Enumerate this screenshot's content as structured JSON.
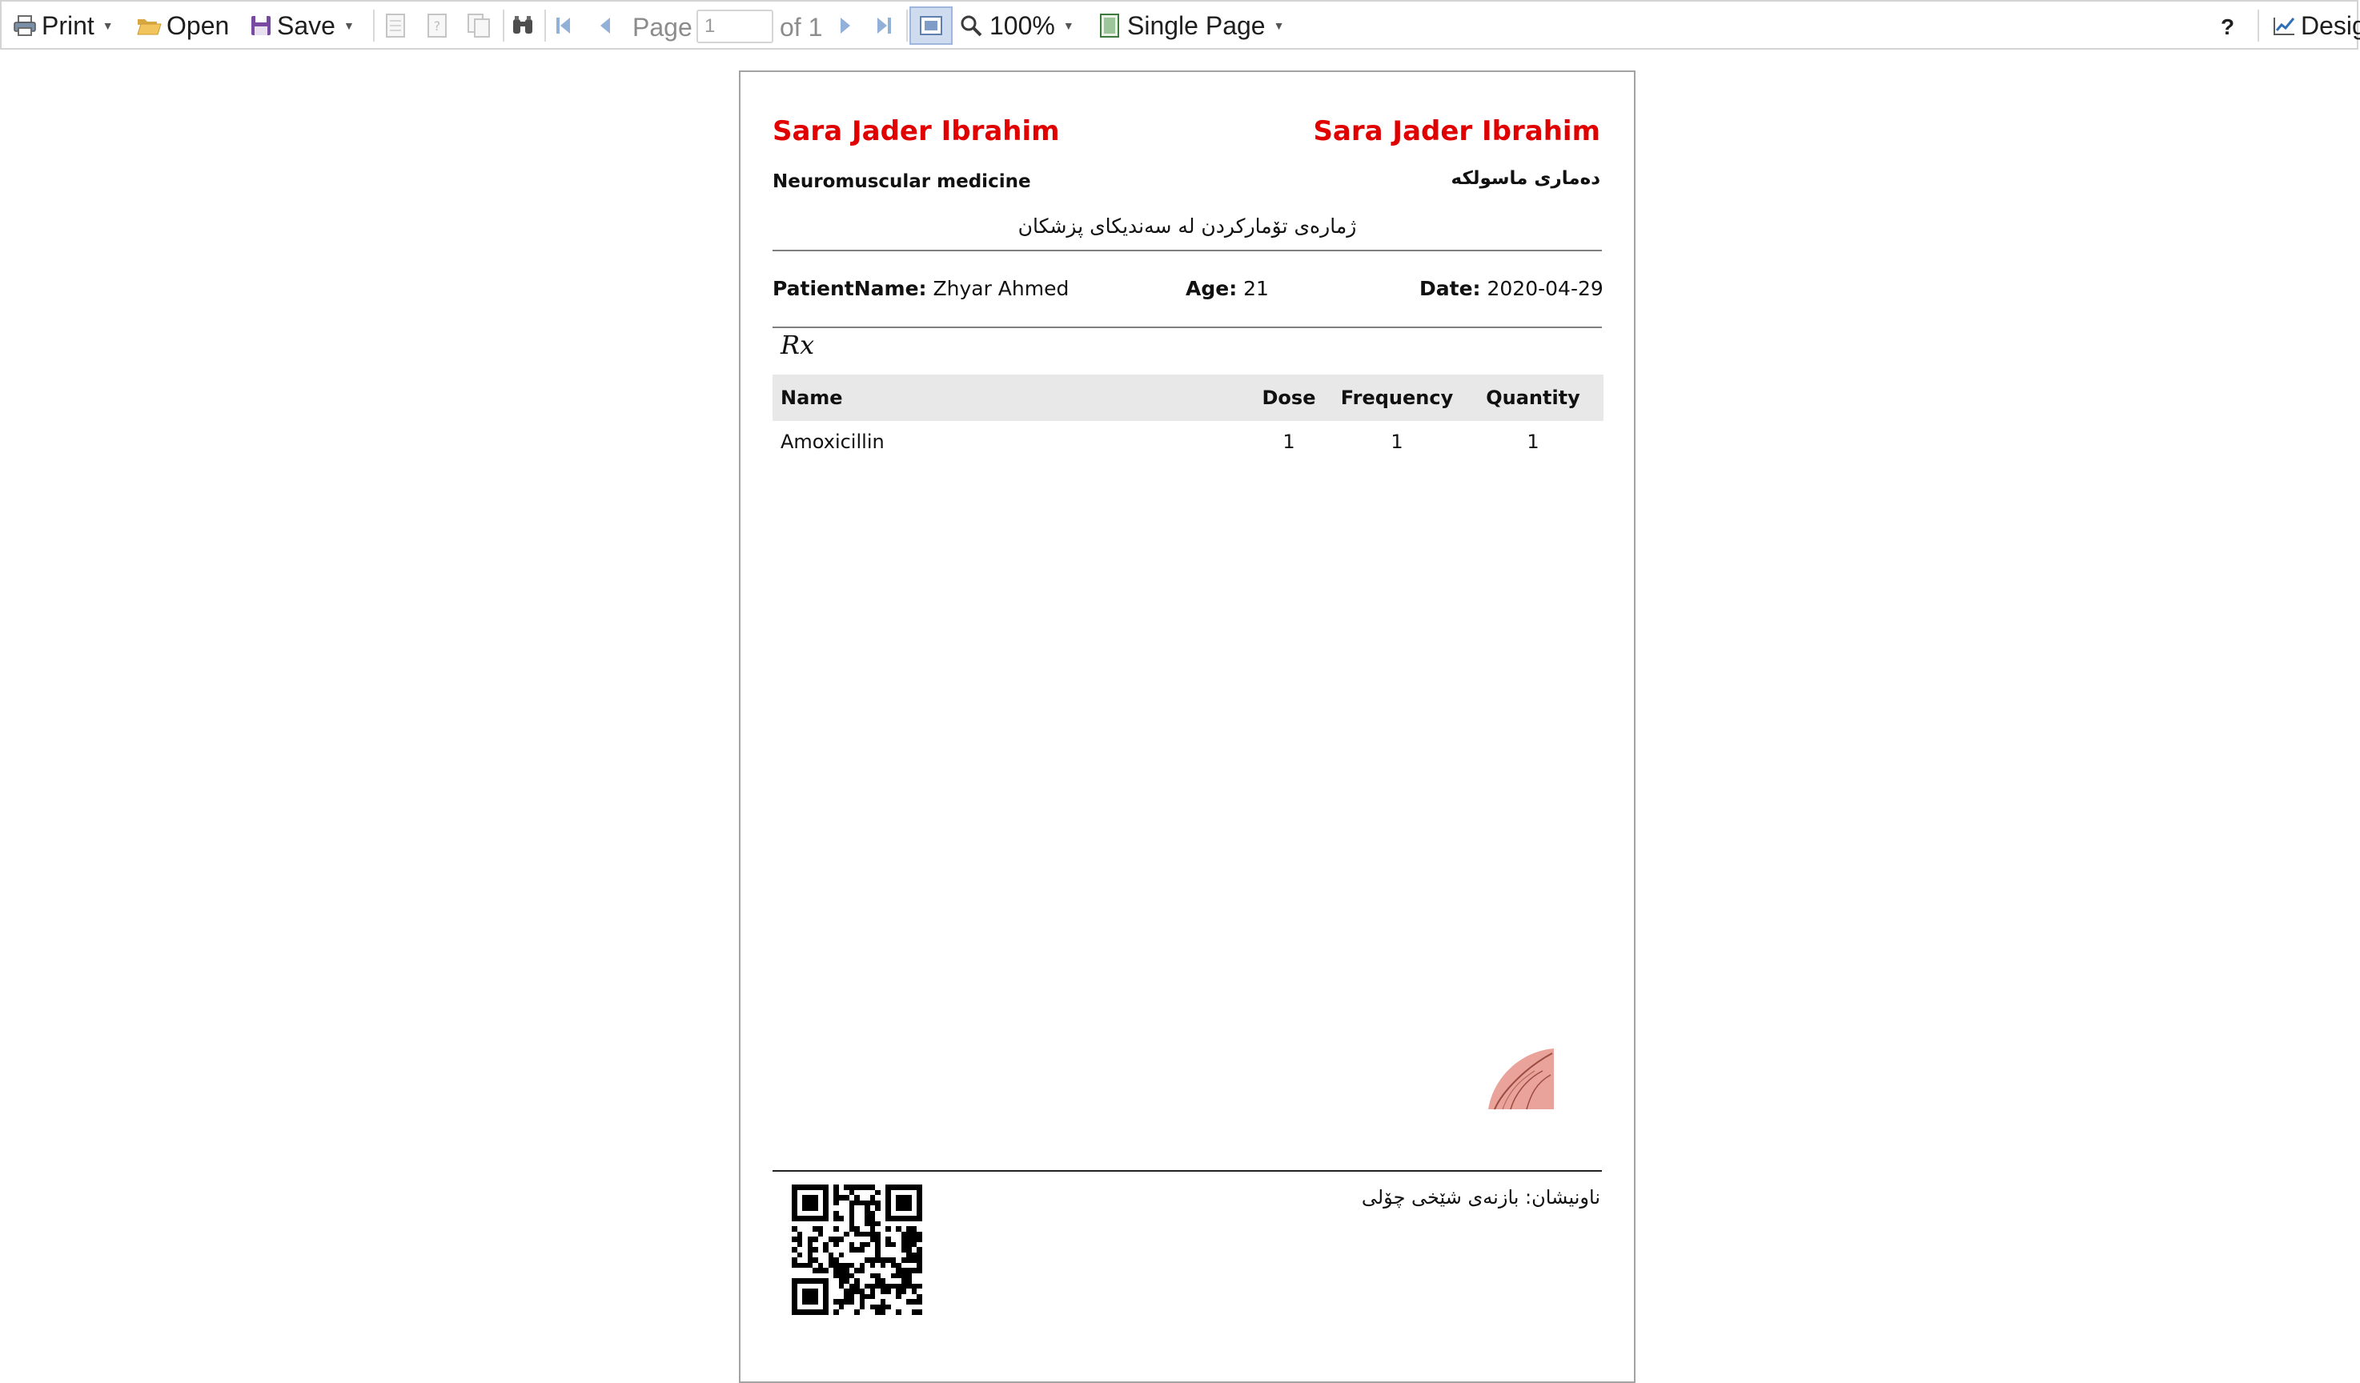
{
  "toolbar": {
    "print_label": "Print",
    "open_label": "Open",
    "save_label": "Save",
    "page_label": "Page",
    "page_input_value": "1",
    "page_of": "of 1",
    "zoom_value": "100%",
    "view_mode": "Single Page",
    "help_label": "?",
    "design_label": "Desig"
  },
  "report": {
    "doctor_name_en": "Sara Jader Ibrahim",
    "doctor_name_right": "Sara Jader Ibrahim",
    "specialty_en": "Neuromuscular medicine",
    "specialty_ku": "دەماری ماسولکە",
    "registration_line": "ژمارەی تۆمارکردن لە سەندیکای پزشکان",
    "patient_label": "PatientName:",
    "patient_value": "Zhyar Ahmed",
    "age_label": "Age:",
    "age_value": "21",
    "date_label": "Date:",
    "date_value": "2020-04-29",
    "rx_label": "Rx",
    "table": {
      "headers": [
        "Name",
        "Dose",
        "Frequency",
        "Quantity"
      ],
      "rows": [
        [
          "Amoxicillin",
          "1",
          "1",
          "1"
        ]
      ]
    },
    "address": "ناونیشان:  بازنەی شێخی چۆلی"
  },
  "colors": {
    "doctor_name": "#e00000",
    "table_header_bg": "#e8e8e8",
    "toolbar_active_bg": "#cfdcf0"
  },
  "icons": [
    "printer-icon",
    "folder-open-icon",
    "floppy-disk-icon",
    "binoculars-icon",
    "first-page-icon",
    "previous-page-icon",
    "next-page-icon",
    "last-page-icon",
    "magnifier-icon",
    "single-page-icon",
    "design-icon",
    "qr-code",
    "logo-leaf"
  ]
}
